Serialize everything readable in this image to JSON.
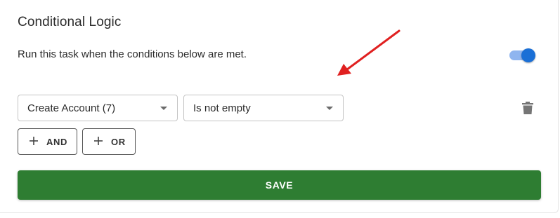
{
  "panel": {
    "title": "Conditional Logic",
    "description": "Run this task when the conditions below are met.",
    "toggle_on": true,
    "toggle_color": "#1a6fd6"
  },
  "condition": {
    "field_select_value": "Create Account (7)",
    "operator_select_value": "Is not empty",
    "delete_icon": "trash-icon"
  },
  "buttons": {
    "and_label": "AND",
    "or_label": "OR",
    "save_label": "SAVE",
    "save_color": "#2e7d32"
  },
  "annotation": {
    "arrow_color": "#e02020"
  }
}
